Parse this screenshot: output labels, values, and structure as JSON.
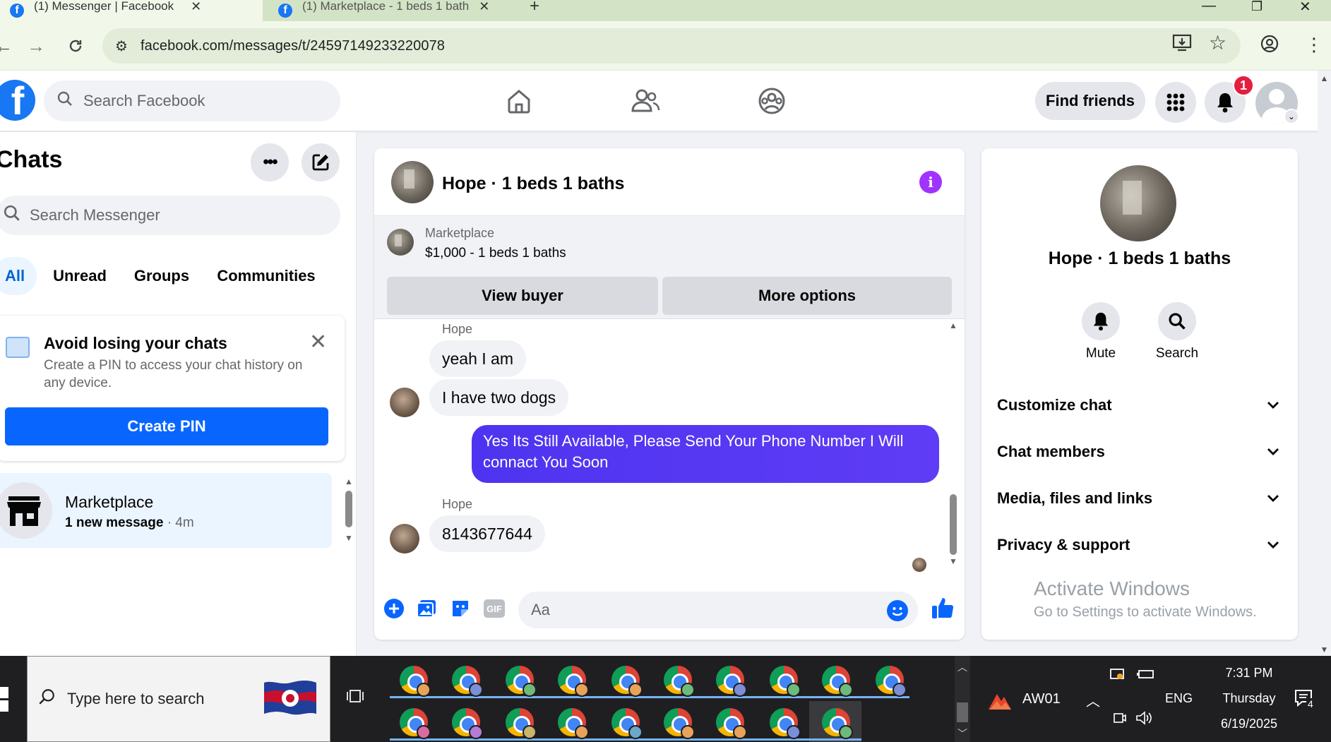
{
  "browser": {
    "tabs": [
      {
        "title": "(1) Messenger | Facebook",
        "active": true
      },
      {
        "title": "(1) Marketplace - 1 beds 1 bath",
        "active": false
      }
    ],
    "new_tab": "+",
    "url": "facebook.com/messages/t/24597149233220078"
  },
  "fb_header": {
    "logo": "f",
    "search_placeholder": "Search Facebook",
    "find_friends": "Find friends",
    "notification_count": "1"
  },
  "chats": {
    "title": "Chats",
    "search_placeholder": "Search Messenger",
    "filters": [
      "All",
      "Unread",
      "Groups",
      "Communities"
    ],
    "pin_card": {
      "title": "Avoid losing your chats",
      "description": "Create a PIN to access your chat history on any device.",
      "button": "Create PIN"
    },
    "items": [
      {
        "name": "Marketplace",
        "preview": "1 new message",
        "time": " · 4m"
      }
    ]
  },
  "conversation": {
    "title": "Hope · 1 beds 1 baths",
    "marketplace": {
      "label": "Marketplace",
      "listing": "$1,000 - 1 beds 1 baths",
      "view_buyer": "View buyer",
      "more_options": "More options"
    },
    "messages": [
      {
        "sender": "Hope",
        "text": "yeah I am"
      },
      {
        "sender": "Hope",
        "text": "I have two dogs"
      },
      {
        "sender": "me",
        "text": "Yes Its Still Available, Please Send Your Phone Number I Will connact You Soon"
      },
      {
        "sender": "Hope",
        "text": "8143677644"
      }
    ],
    "composer_placeholder": "Aa",
    "gif_label": "GIF"
  },
  "details": {
    "name": "Hope · 1 beds 1 baths",
    "actions": [
      "Mute",
      "Search"
    ],
    "sections": [
      "Customize chat",
      "Chat members",
      "Media, files and links",
      "Privacy & support"
    ],
    "watermark_title": "Activate Windows",
    "watermark_sub": "Go to Settings to activate Windows."
  },
  "taskbar": {
    "search_placeholder": "Type here to search",
    "app_label": "AW01",
    "language": "ENG",
    "time": "7:31 PM",
    "day": "Thursday",
    "date": "6/19/2025",
    "notification_count": "4"
  },
  "colors": {
    "facebook_blue": "#1877f2",
    "messenger_out": "#5634f2",
    "info_purple": "#a033ff",
    "browser_frame": "#d3e3c5"
  }
}
